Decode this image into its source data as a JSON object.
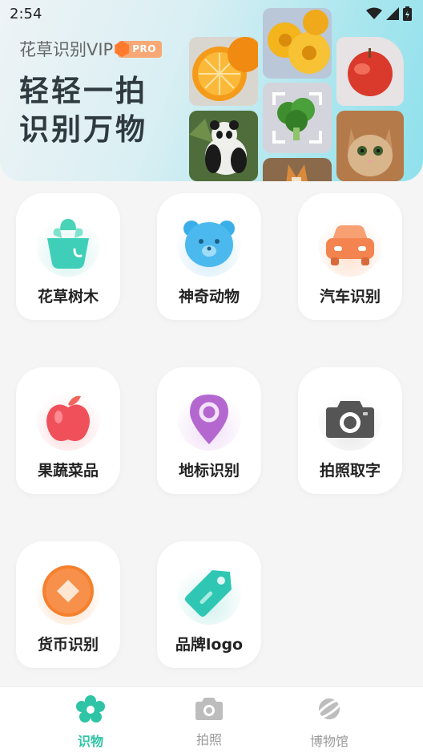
{
  "status": {
    "time": "2:54"
  },
  "banner": {
    "vip_label": "花草识别VIP",
    "pro_label": "PRO",
    "headline_line1": "轻轻一拍",
    "headline_line2": "识别万物"
  },
  "categories": [
    {
      "label": "花草树木",
      "icon": "potted-plant-icon",
      "color": "#3fcfb8"
    },
    {
      "label": "神奇动物",
      "icon": "bear-face-icon",
      "color": "#3aaee8"
    },
    {
      "label": "汽车识别",
      "icon": "car-icon",
      "color": "#f3844f"
    },
    {
      "label": "果蔬菜品",
      "icon": "apple-icon",
      "color": "#f0505a"
    },
    {
      "label": "地标识别",
      "icon": "map-pin-icon",
      "color": "#b468cf"
    },
    {
      "label": "拍照取字",
      "icon": "camera-icon",
      "color": "#555555"
    },
    {
      "label": "货币识别",
      "icon": "coin-icon",
      "color": "#f5802d"
    },
    {
      "label": "品牌logo",
      "icon": "price-tag-icon",
      "color": "#2fc7b3"
    }
  ],
  "nav": [
    {
      "label": "识物",
      "icon": "flower-icon",
      "active": true
    },
    {
      "label": "拍照",
      "icon": "camera-icon",
      "active": false
    },
    {
      "label": "博物馆",
      "icon": "planet-icon",
      "active": false
    }
  ],
  "colors": {
    "accent": "#2ec4a5",
    "nav_inactive": "#9a9a9a"
  }
}
